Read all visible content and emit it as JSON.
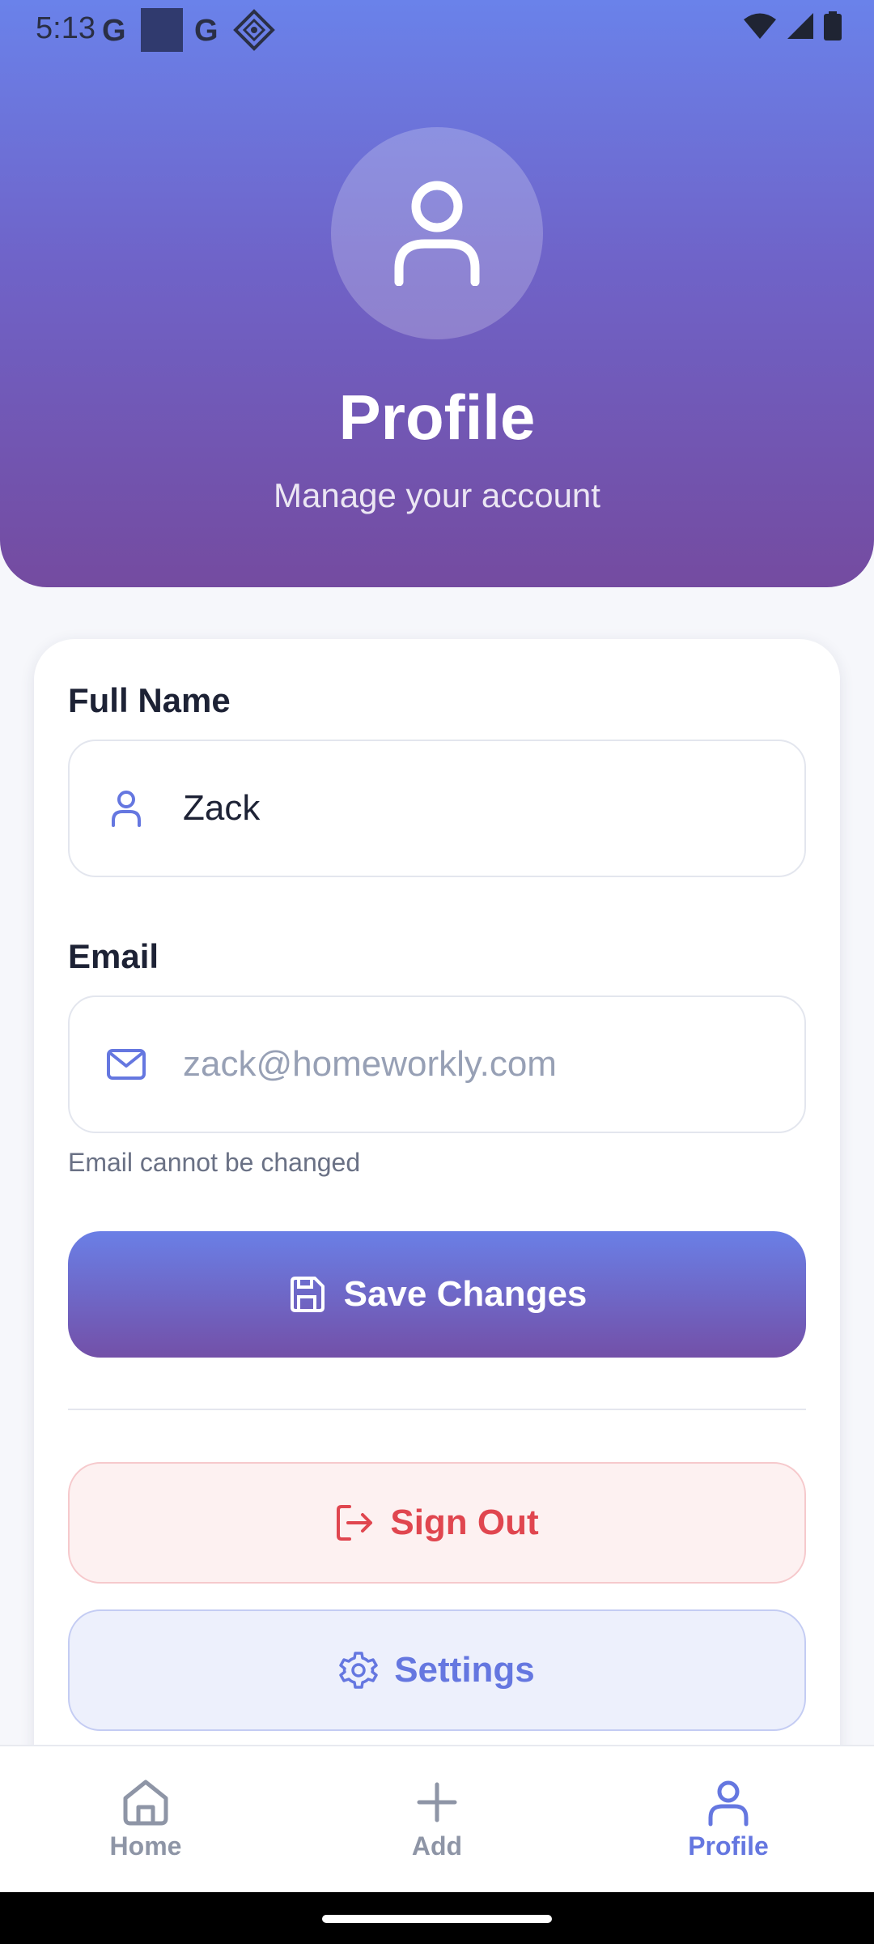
{
  "status_bar": {
    "time": "5:13",
    "left_icons": [
      "google-g-icon",
      "app-square-icon",
      "google-g-icon",
      "diamond-app-icon"
    ],
    "right_icons": [
      "wifi-icon",
      "cell-signal-icon",
      "battery-icon"
    ]
  },
  "header": {
    "title": "Profile",
    "subtitle": "Manage your account",
    "avatar_icon": "user-icon"
  },
  "form": {
    "full_name": {
      "label": "Full Name",
      "value": "Zack",
      "icon": "user-icon"
    },
    "email": {
      "label": "Email",
      "value": "zack@homeworkly.com",
      "icon": "mail-icon",
      "hint": "Email cannot be changed"
    },
    "save_label": "Save Changes",
    "sign_out_label": "Sign Out",
    "settings_label": "Settings"
  },
  "bottom_nav": {
    "items": [
      {
        "label": "Home",
        "icon": "home-icon",
        "active": false
      },
      {
        "label": "Add",
        "icon": "plus-icon",
        "active": false
      },
      {
        "label": "Profile",
        "icon": "user-icon",
        "active": true
      }
    ]
  },
  "colors": {
    "header_top": "#6a82ea",
    "header_bottom": "#744ba0",
    "accent": "#6577e0",
    "danger": "#e0464f"
  }
}
